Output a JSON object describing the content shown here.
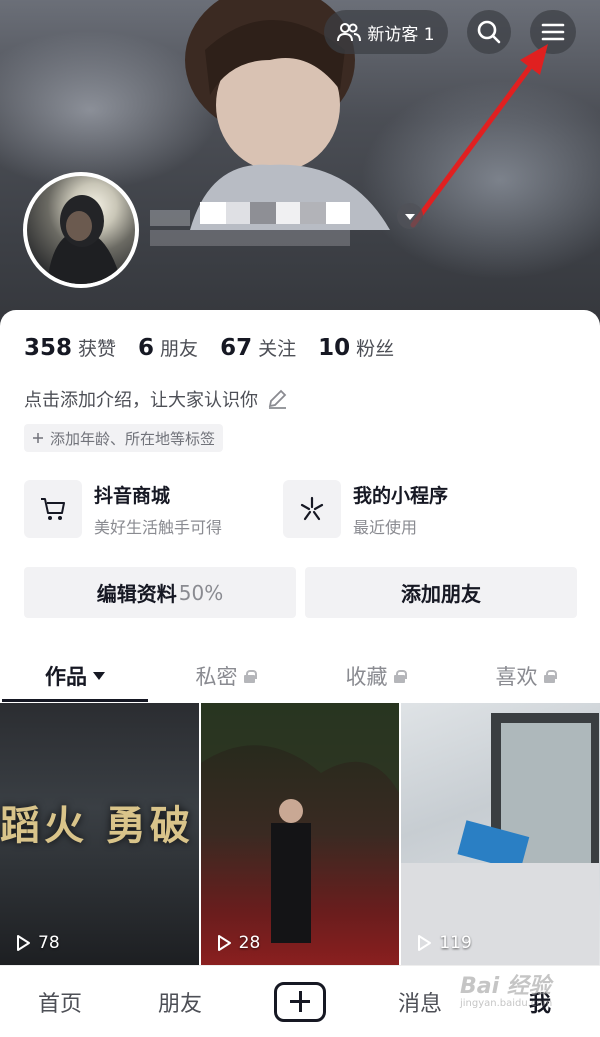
{
  "header": {
    "visitor_label": "新访客 1",
    "visitor_icon": "users-icon",
    "search_icon": "search-icon",
    "menu_icon": "menu-icon"
  },
  "profile": {
    "stats": [
      {
        "num": "358",
        "label": "获赞"
      },
      {
        "num": "6",
        "label": "朋友"
      },
      {
        "num": "67",
        "label": "关注"
      },
      {
        "num": "10",
        "label": "粉丝"
      }
    ],
    "bio_placeholder": "点击添加介绍，让大家认识你",
    "tag_placeholder": "添加年龄、所在地等标签"
  },
  "services": [
    {
      "title": "抖音商城",
      "subtitle": "美好生活触手可得",
      "icon": "cart-icon"
    },
    {
      "title": "我的小程序",
      "subtitle": "最近使用",
      "icon": "mini-program-icon"
    }
  ],
  "actions": {
    "edit_label": "编辑资料",
    "edit_progress": "50%",
    "add_friend_label": "添加朋友"
  },
  "tabs": [
    {
      "label": "作品",
      "active": true
    },
    {
      "label": "私密",
      "locked": true
    },
    {
      "label": "收藏",
      "locked": true
    },
    {
      "label": "喜欢",
      "locked": true
    }
  ],
  "videos": [
    {
      "plays": "78",
      "caption": "蹈火 勇破"
    },
    {
      "plays": "28"
    },
    {
      "plays": "119"
    }
  ],
  "bottom_nav": [
    "首页",
    "朋友",
    "消息",
    "我"
  ],
  "watermark": {
    "main": "Bai 经验",
    "sub": "jingyan.baidu.com"
  },
  "colors": {
    "arrow": "#e02020",
    "text_primary": "#161823",
    "text_secondary": "#8a8b91"
  }
}
